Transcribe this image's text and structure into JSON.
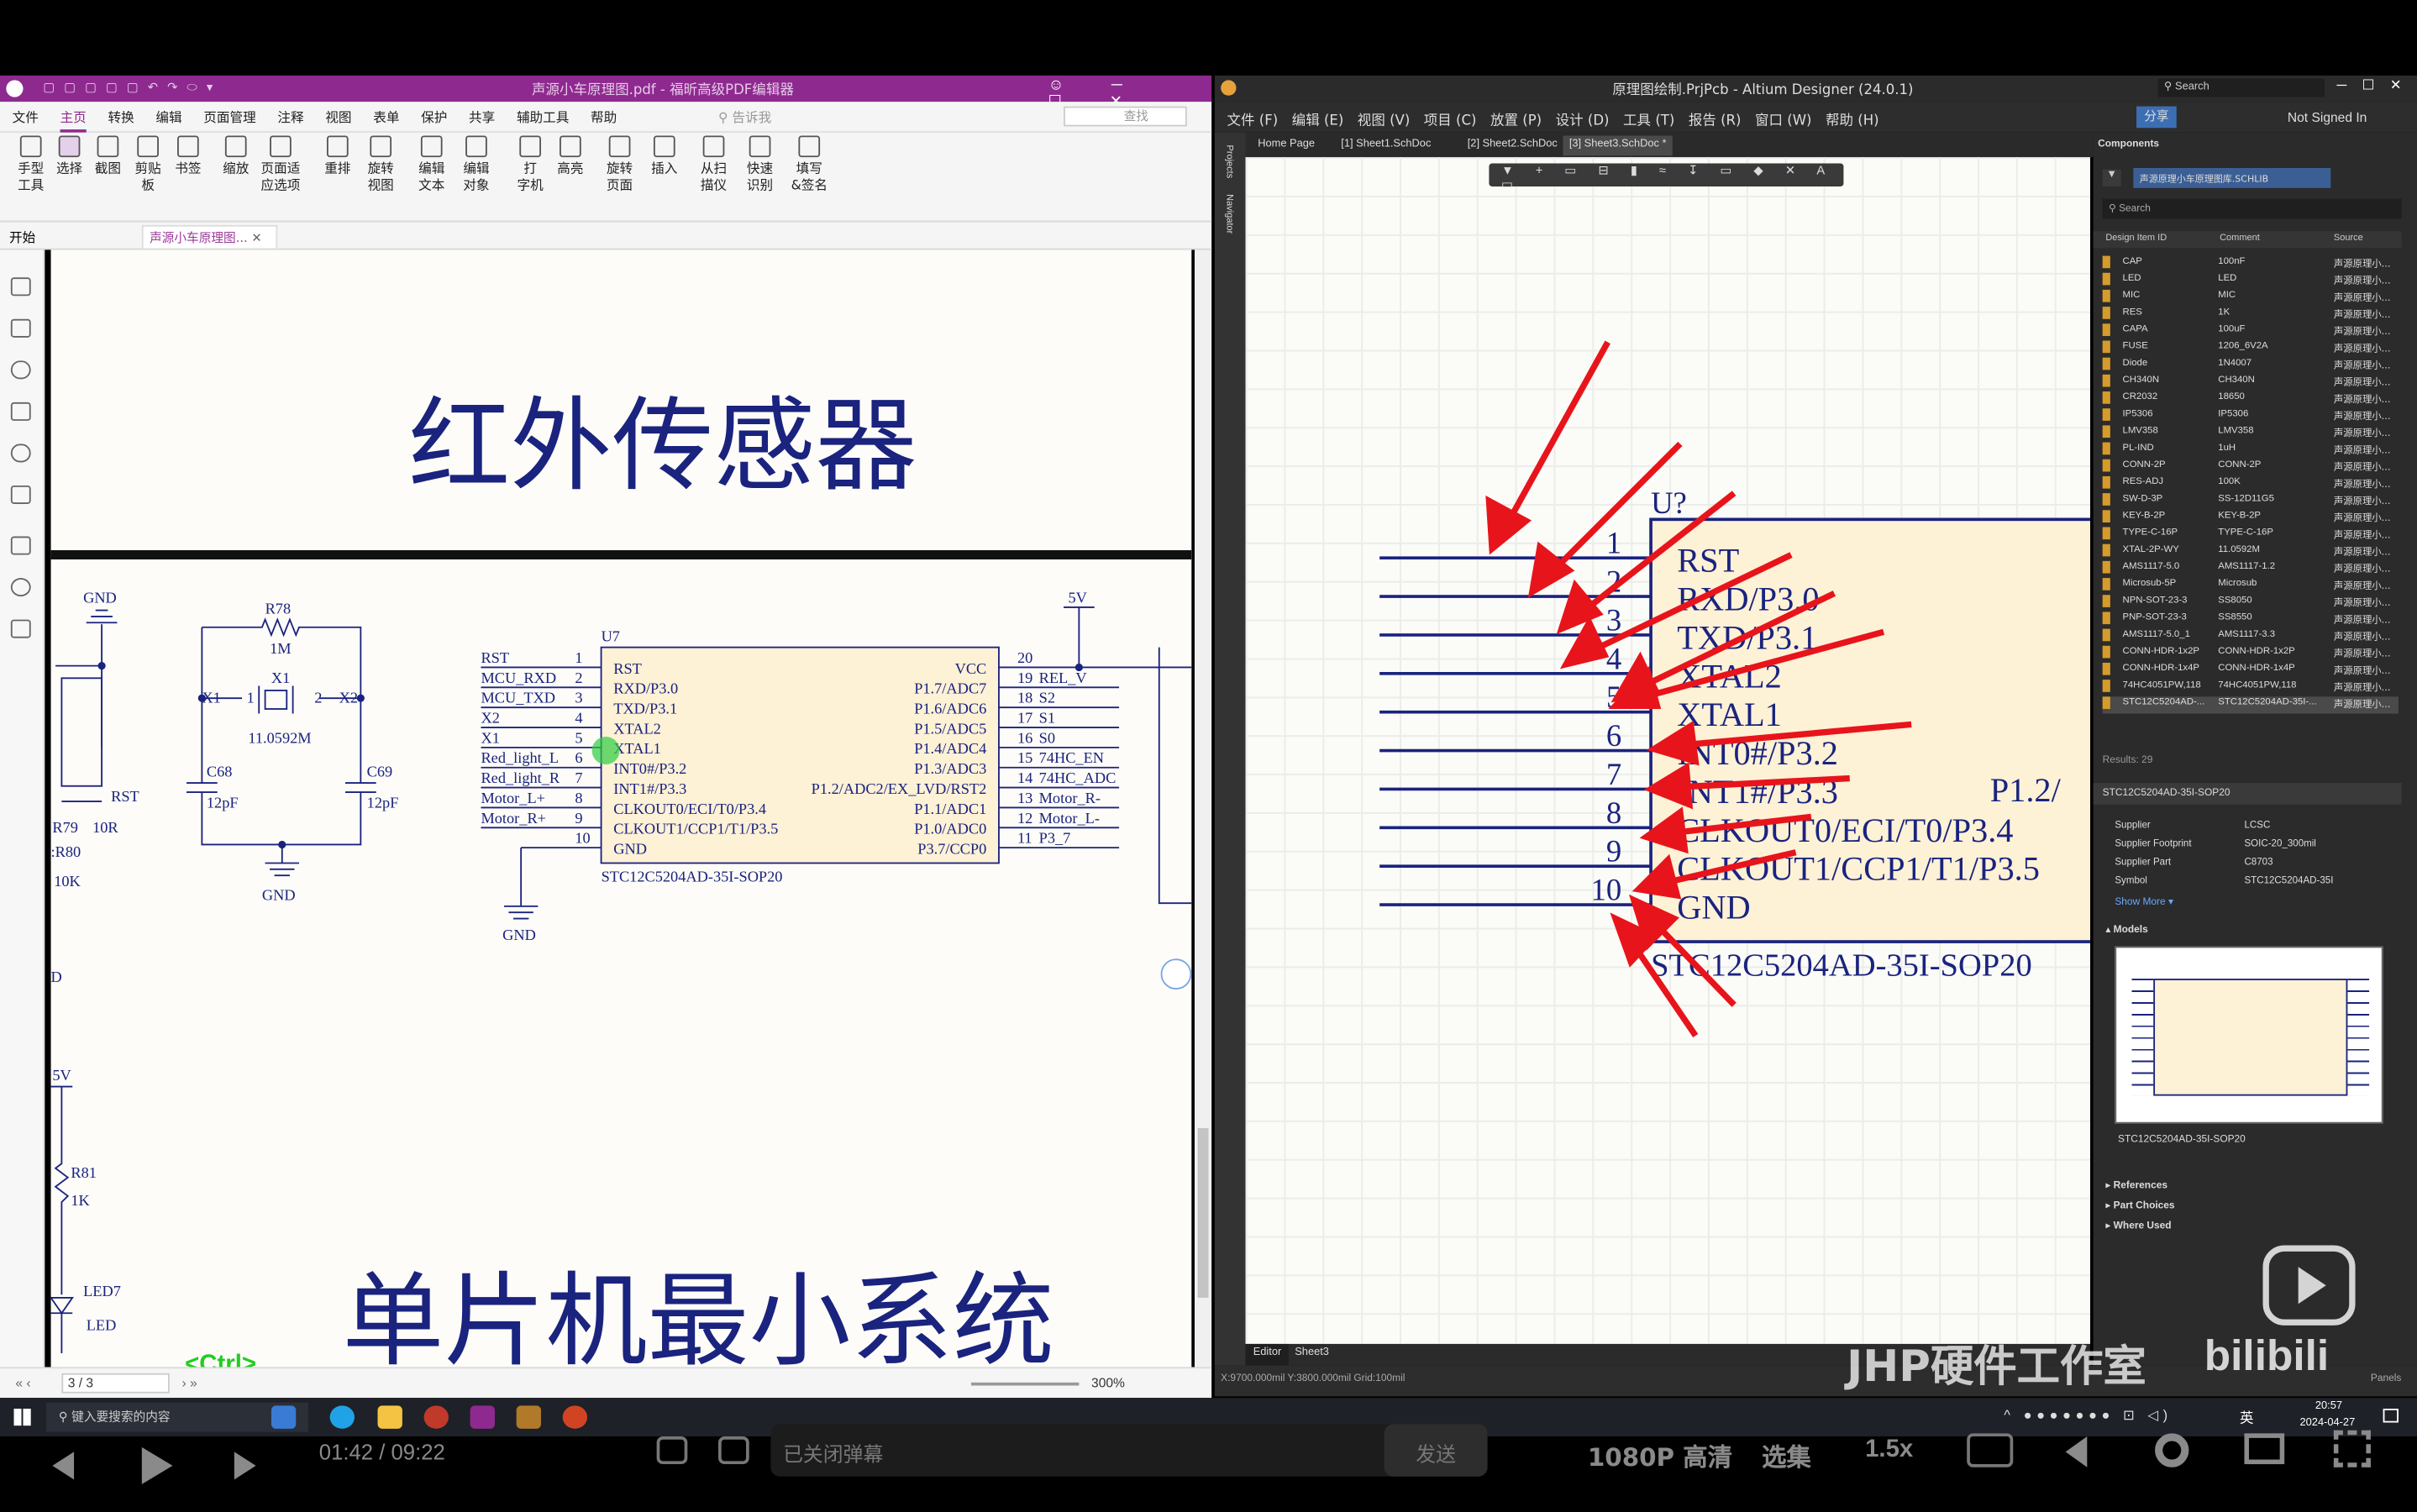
{
  "foxit": {
    "title": "声源小车原理图.pdf - 福昕高级PDF编辑器",
    "menu": [
      "文件",
      "主页",
      "转换",
      "编辑",
      "页面管理",
      "注释",
      "视图",
      "表单",
      "保护",
      "共享",
      "辅助工具",
      "帮助"
    ],
    "tell_me": "告诉我",
    "find": "查找",
    "ribbon": [
      [
        "手型",
        "工具"
      ],
      [
        "选择",
        ""
      ],
      [
        "截图",
        ""
      ],
      [
        "剪贴",
        "板"
      ],
      [
        "书签",
        ""
      ],
      [
        "缩放",
        ""
      ],
      [
        "页面适",
        "应选项"
      ],
      [
        "重排",
        ""
      ],
      [
        "旋转",
        "视图"
      ],
      [
        "编辑",
        "文本"
      ],
      [
        "编辑",
        "对象"
      ],
      [
        "打",
        "字机"
      ],
      [
        "高亮",
        ""
      ],
      [
        "旋转",
        "页面"
      ],
      [
        "插入",
        ""
      ],
      [
        "从扫",
        "描仪"
      ],
      [
        "快速",
        "识别"
      ],
      [
        "填写",
        "&签名"
      ]
    ],
    "tabs": {
      "start": "开始",
      "doc": "声源小车原理图..."
    },
    "status": {
      "page": "3 / 3",
      "zoom": "300%"
    }
  },
  "schematic_left": {
    "heading1": "红外传感器",
    "heading2": "单片机最小系统",
    "gnd": "GND",
    "r78": "R78",
    "r78v": "1M",
    "x1": "X1",
    "x1v": "11.0592M",
    "x1a": "X1",
    "x2a": "X2",
    "n1": "1",
    "n2": "2",
    "c68": "C68",
    "c68v": "12pF",
    "c69": "C69",
    "c69v": "12pF",
    "gnd2": "GND",
    "gnd3": "GND",
    "rst": "RST",
    "r79": "R79",
    "r79v": "10R",
    "r80": ":R80",
    "r80v": "10K",
    "v5a": "5V",
    "v5b": "5V",
    "r81": "R81",
    "r81v": "1K",
    "led7": "LED7",
    "led": "LED",
    "d": "D",
    "u7": "U7",
    "ic_name": "STC12C5204AD-35I-SOP20",
    "nets_left": [
      "RST",
      "MCU_RXD",
      "MCU_TXD",
      "X2",
      "X1",
      "Red_light_L",
      "Red_light_R",
      "Motor_L+",
      "Motor_R+",
      ""
    ],
    "pins_left": [
      "1",
      "2",
      "3",
      "4",
      "5",
      "6",
      "7",
      "8",
      "9",
      "10"
    ],
    "inner_left": [
      "RST",
      "RXD/P3.0",
      "TXD/P3.1",
      "XTAL2",
      "XTAL1",
      "INT0#/P3.2",
      "INT1#/P3.3",
      "CLKOUT0/ECI/T0/P3.4",
      "CLKOUT1/CCP1/T1/P3.5",
      "GND"
    ],
    "inner_right": [
      "VCC",
      "P1.7/ADC7",
      "P1.6/ADC6",
      "P1.5/ADC5",
      "P1.4/ADC4",
      "P1.3/ADC3",
      "P1.2/ADC2/EX_LVD/RST2",
      "P1.1/ADC1",
      "P1.0/ADC0",
      "P3.7/CCP0"
    ],
    "pins_right": [
      "20",
      "19",
      "18",
      "17",
      "16",
      "15",
      "14",
      "13",
      "12",
      "11"
    ],
    "nets_right": [
      "",
      "REL_V",
      "S2",
      "S1",
      "S0",
      "74HC_EN",
      "74HC_ADC",
      "Motor_R-",
      "Motor_L-",
      "P3_7"
    ],
    "ctrl": "<Ctrl>"
  },
  "altium": {
    "title": "原理图绘制.PrjPcb - Altium Designer (24.0.1)",
    "search": "Search",
    "menu": [
      "文件 (F)",
      "编辑 (E)",
      "视图 (V)",
      "项目 (C)",
      "放置 (P)",
      "设计 (D)",
      "工具 (T)",
      "报告 (R)",
      "窗口 (W)",
      "帮助 (H)"
    ],
    "share": "分享",
    "signed": "Not Signed In",
    "side": [
      "Projects",
      "Navigator"
    ],
    "tabs": [
      "Home Page",
      "[1] Sheet1.SchDoc",
      "[2] Sheet2.SchDoc",
      "[3] Sheet3.SchDoc *"
    ],
    "designator": "U?",
    "pins": [
      "1",
      "2",
      "3",
      "4",
      "5",
      "6",
      "7",
      "8",
      "9",
      "10"
    ],
    "pin_names": [
      "RST",
      "RXD/P3.0",
      "TXD/P3.1",
      "XTAL2",
      "XTAL1",
      "INT0#/P3.2",
      "INT1#/P3.3",
      "CLKOUT0/ECI/T0/P3.4",
      "CLKOUT1/CCP1/T1/P3.5",
      "GND"
    ],
    "right_pin": "P1.2/",
    "comment": "STC12C5204AD-35I-SOP20",
    "editor_tab": "Editor",
    "sheet_tab": "Sheet3",
    "status": "X:9700.000mil Y:3800.000mil    Grid:100mil",
    "panels": "Panels"
  },
  "components": {
    "title": "Components",
    "lib": "声源原理小车原理图库.SCHLIB",
    "search": "Search",
    "headers": [
      "Design Item ID",
      "Comment",
      "Source"
    ],
    "rows": [
      [
        "CAP",
        "100nF",
        "声源原理小..."
      ],
      [
        "LED",
        "LED",
        "声源原理小..."
      ],
      [
        "MIC",
        "MIC",
        "声源原理小..."
      ],
      [
        "RES",
        "1K",
        "声源原理小..."
      ],
      [
        "CAPA",
        "100uF",
        "声源原理小..."
      ],
      [
        "FUSE",
        "1206_6V2A",
        "声源原理小..."
      ],
      [
        "Diode",
        "1N4007",
        "声源原理小..."
      ],
      [
        "CH340N",
        "CH340N",
        "声源原理小..."
      ],
      [
        "CR2032",
        "18650",
        "声源原理小..."
      ],
      [
        "IP5306",
        "IP5306",
        "声源原理小..."
      ],
      [
        "LMV358",
        "LMV358",
        "声源原理小..."
      ],
      [
        "PL-IND",
        "1uH",
        "声源原理小..."
      ],
      [
        "CONN-2P",
        "CONN-2P",
        "声源原理小..."
      ],
      [
        "RES-ADJ",
        "100K",
        "声源原理小..."
      ],
      [
        "SW-D-3P",
        "SS-12D11G5",
        "声源原理小..."
      ],
      [
        "KEY-B-2P",
        "KEY-B-2P",
        "声源原理小..."
      ],
      [
        "TYPE-C-16P",
        "TYPE-C-16P",
        "声源原理小..."
      ],
      [
        "XTAL-2P-WY",
        "11.0592M",
        "声源原理小..."
      ],
      [
        "AMS1117-5.0",
        "AMS1117-1.2",
        "声源原理小..."
      ],
      [
        "Microsub-5P",
        "Microsub",
        "声源原理小..."
      ],
      [
        "NPN-SOT-23-3",
        "SS8050",
        "声源原理小..."
      ],
      [
        "PNP-SOT-23-3",
        "SS8550",
        "声源原理小..."
      ],
      [
        "AMS1117-5.0_1",
        "AMS1117-3.3",
        "声源原理小..."
      ],
      [
        "CONN-HDR-1x2P",
        "CONN-HDR-1x2P",
        "声源原理小..."
      ],
      [
        "CONN-HDR-1x4P",
        "CONN-HDR-1x4P",
        "声源原理小..."
      ],
      [
        "74HC4051PW,118",
        "74HC4051PW,118",
        "声源原理小..."
      ],
      [
        "STC12C5204AD-...",
        "STC12C5204AD-35I-...",
        "声源原理小..."
      ]
    ],
    "results": "Results: 29",
    "selected": "STC12C5204AD-35I-SOP20",
    "props": [
      [
        "Supplier",
        "LCSC"
      ],
      [
        "Supplier Footprint",
        "SOIC-20_300mil"
      ],
      [
        "Supplier Part",
        "C8703"
      ],
      [
        "Symbol",
        "STC12C5204AD-35I"
      ]
    ],
    "show_more": "Show More ▾",
    "models": "Models",
    "model_name": "STC12C5204AD-35I-SOP20",
    "sections": [
      "References",
      "Part Choices",
      "Where Used"
    ]
  },
  "taskbar": {
    "search": "键入要搜索的内容",
    "ime": "英",
    "time": "20:57",
    "date": "2024-04-27"
  },
  "player": {
    "time": "01:42 / 09:22",
    "danmaku": "已关闭弹幕",
    "send": "发送",
    "quality": "1080P 高清",
    "select": "选集",
    "speed": "1.5x"
  },
  "watermark": "JHP硬件工作室"
}
